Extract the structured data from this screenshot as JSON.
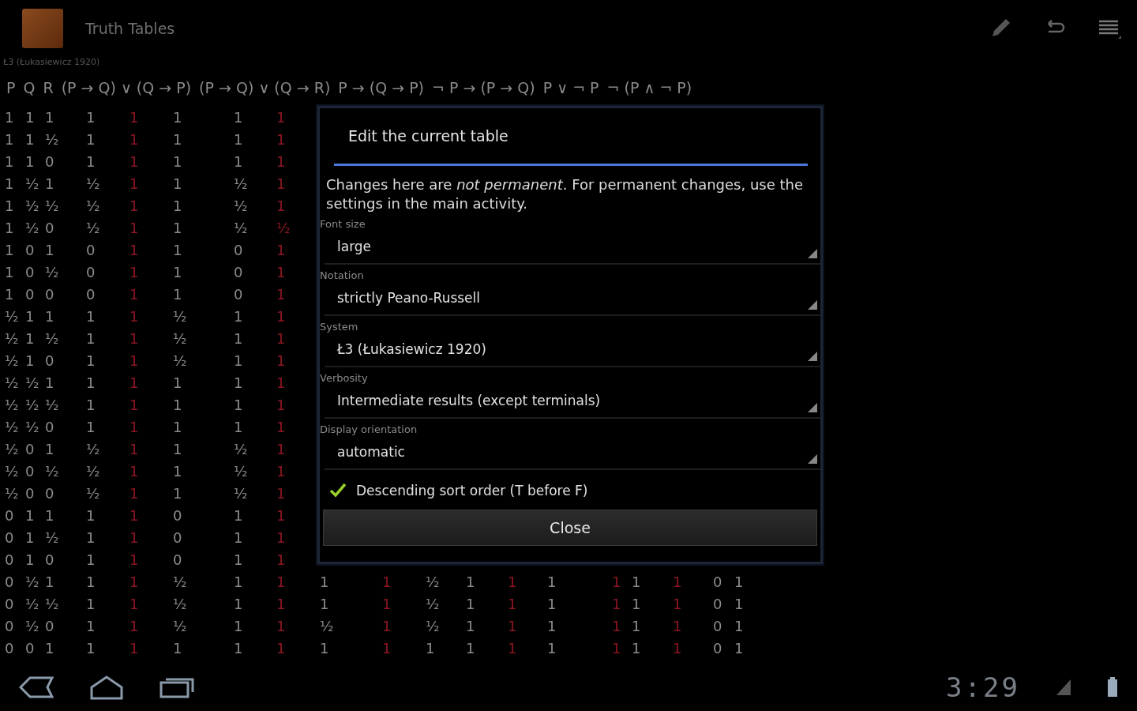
{
  "action_bar": {
    "title": "Truth Tables",
    "subtitle": "Ł3 (Łukasiewicz 1920)"
  },
  "table": {
    "headers": [
      "P",
      "Q",
      "R",
      "(P → Q) ∨ (Q → P)",
      "(P → Q) ∨ (Q → R)",
      "P → (Q → P)",
      "¬ P → (P → Q)",
      "P ∨ ¬ P",
      "¬ (P ∧ ¬ P)"
    ],
    "columns": [
      {
        "main": false
      },
      {
        "main": false
      },
      {
        "main": false
      },
      {
        "main": false
      },
      {
        "main": true
      },
      {
        "main": false
      },
      {
        "main": false
      },
      {
        "main": true
      },
      {
        "main": false
      },
      {
        "main": true
      },
      {
        "main": false
      },
      {
        "main": false
      },
      {
        "main": true
      },
      {
        "main": false
      },
      {
        "main": true
      },
      {
        "main": false
      },
      {
        "main": true
      },
      {
        "main": false
      },
      {
        "main": false
      }
    ],
    "rows": [
      [
        "1",
        "1",
        "1",
        "1",
        "1",
        "1",
        "1",
        "1"
      ],
      [
        "1",
        "1",
        "½",
        "1",
        "1",
        "1",
        "1",
        "1"
      ],
      [
        "1",
        "1",
        "0",
        "1",
        "1",
        "1",
        "1",
        "1"
      ],
      [
        "1",
        "½",
        "1",
        "½",
        "1",
        "1",
        "½",
        "1"
      ],
      [
        "1",
        "½",
        "½",
        "½",
        "1",
        "1",
        "½",
        "1"
      ],
      [
        "1",
        "½",
        "0",
        "½",
        "1",
        "1",
        "½",
        "½"
      ],
      [
        "1",
        "0",
        "1",
        "0",
        "1",
        "1",
        "0",
        "1"
      ],
      [
        "1",
        "0",
        "½",
        "0",
        "1",
        "1",
        "0",
        "1"
      ],
      [
        "1",
        "0",
        "0",
        "0",
        "1",
        "1",
        "0",
        "1"
      ],
      [
        "½",
        "1",
        "1",
        "1",
        "1",
        "½",
        "1",
        "1"
      ],
      [
        "½",
        "1",
        "½",
        "1",
        "1",
        "½",
        "1",
        "1"
      ],
      [
        "½",
        "1",
        "0",
        "1",
        "1",
        "½",
        "1",
        "1"
      ],
      [
        "½",
        "½",
        "1",
        "1",
        "1",
        "1",
        "1",
        "1"
      ],
      [
        "½",
        "½",
        "½",
        "1",
        "1",
        "1",
        "1",
        "1"
      ],
      [
        "½",
        "½",
        "0",
        "1",
        "1",
        "1",
        "1",
        "1"
      ],
      [
        "½",
        "0",
        "1",
        "½",
        "1",
        "1",
        "½",
        "1"
      ],
      [
        "½",
        "0",
        "½",
        "½",
        "1",
        "1",
        "½",
        "1"
      ],
      [
        "½",
        "0",
        "0",
        "½",
        "1",
        "1",
        "½",
        "1"
      ],
      [
        "0",
        "1",
        "1",
        "1",
        "1",
        "0",
        "1",
        "1"
      ],
      [
        "0",
        "1",
        "½",
        "1",
        "1",
        "0",
        "1",
        "1"
      ],
      [
        "0",
        "1",
        "0",
        "1",
        "1",
        "0",
        "1",
        "1"
      ],
      [
        "0",
        "½",
        "1",
        "1",
        "1",
        "½",
        "1",
        "1",
        "1",
        "1",
        "½",
        "1",
        "1",
        "1",
        "1",
        "1",
        "1",
        "0",
        "1"
      ],
      [
        "0",
        "½",
        "½",
        "1",
        "1",
        "½",
        "1",
        "1",
        "1",
        "1",
        "½",
        "1",
        "1",
        "1",
        "1",
        "1",
        "1",
        "0",
        "1"
      ],
      [
        "0",
        "½",
        "0",
        "1",
        "1",
        "½",
        "1",
        "1",
        "½",
        "1",
        "½",
        "1",
        "1",
        "1",
        "1",
        "1",
        "1",
        "0",
        "1"
      ],
      [
        "0",
        "0",
        "1",
        "1",
        "1",
        "1",
        "1",
        "1",
        "1",
        "1",
        "1",
        "1",
        "1",
        "1",
        "1",
        "1",
        "1",
        "0",
        "1"
      ]
    ]
  },
  "dialog": {
    "title": "Edit the current table",
    "message": "Changes here are *not permanent*. For permanent changes, use the settings in the main activity.",
    "settings": [
      {
        "label": "Font size",
        "value": "large"
      },
      {
        "label": "Notation",
        "value": "strictly Peano-Russell"
      },
      {
        "label": "System",
        "value": "Ł3 (Łukasiewicz 1920)"
      },
      {
        "label": "Verbosity",
        "value": "Intermediate results (except terminals)"
      },
      {
        "label": "Display orientation",
        "value": "automatic"
      }
    ],
    "checkbox": {
      "label": "Descending sort order (T before F)",
      "checked": true
    },
    "button": "Close"
  },
  "status_bar": {
    "time": "3:29"
  }
}
